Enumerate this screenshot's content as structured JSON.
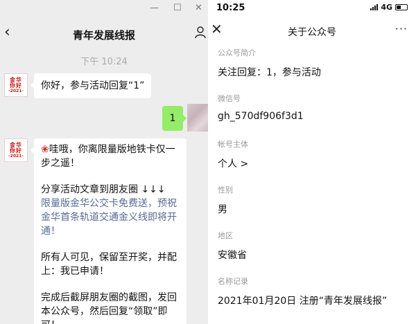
{
  "left": {
    "window_controls": {
      "minimize": "—",
      "maximize": "☐",
      "close": "✕"
    },
    "chat_title": "青年发展线报",
    "time": "下午 10:24",
    "avatar_logo": {
      "line1": "金华",
      "line2": "你好",
      "line3": "-2021-"
    },
    "messages": {
      "m1": "你好，参与活动回复“1”",
      "reply": "1",
      "m2_line1": "哇哦，你离限量版地铁卡仅一步之遥！",
      "m2_line2": "分享活动文章到朋友圈 ↓↓↓",
      "m2_line3": "限量版金华公交卡免费送，预祝金华首条轨道交通金义线即将开通！",
      "m2_line4": "所有人可见，保留至开奖，并配上：我已申请！",
      "m2_line5": "完成后截屏朋友圈的截图，发回本公众号，然后回复“领取”即可！"
    }
  },
  "right": {
    "status": {
      "time": "10:25",
      "network": "4G"
    },
    "title": "关于公众号",
    "more": "···",
    "fields": [
      {
        "label": "公众号简介",
        "value": "关注回复：1，参与活动"
      },
      {
        "label": "微信号",
        "value": "gh_570df906f3d1"
      },
      {
        "label": "帐号主体",
        "value": "个人 >"
      },
      {
        "label": "性别",
        "value": "男"
      },
      {
        "label": "地区",
        "value": "安徽省"
      },
      {
        "label": "名称记录",
        "value": "2021年01月20日 注册“青年发展线报”"
      }
    ]
  }
}
